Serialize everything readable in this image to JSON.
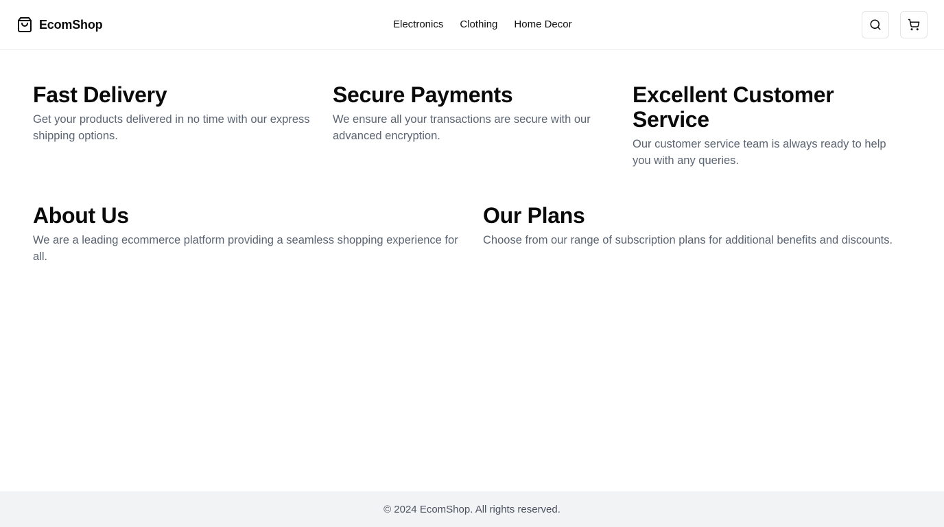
{
  "header": {
    "brand_name": "EcomShop",
    "brand_icon": "shopping-bag-icon",
    "nav": [
      {
        "label": "Electronics"
      },
      {
        "label": "Clothing"
      },
      {
        "label": "Home Decor"
      }
    ],
    "search_icon": "search-icon",
    "cart_icon": "shopping-cart-icon"
  },
  "features": [
    {
      "title": "Fast Delivery",
      "text": "Get your products delivered in no time with our express shipping options."
    },
    {
      "title": "Secure Payments",
      "text": "We ensure all your transactions are secure with our advanced encryption."
    },
    {
      "title": "Excellent Customer Service",
      "text": "Our customer service team is always ready to help you with any queries."
    }
  ],
  "about": {
    "title": "About Us",
    "text": "We are a leading ecommerce platform providing a seamless shopping experience for all."
  },
  "plans": {
    "title": "Our Plans",
    "text": "Choose from our range of subscription plans for additional benefits and discounts."
  },
  "footer": {
    "text": "© 2024 EcomShop. All rights reserved."
  },
  "colors": {
    "text": "#0a0a0a",
    "muted_text": "#5b6472",
    "footer_bg": "#f2f3f5",
    "border": "#e4e4e7"
  }
}
